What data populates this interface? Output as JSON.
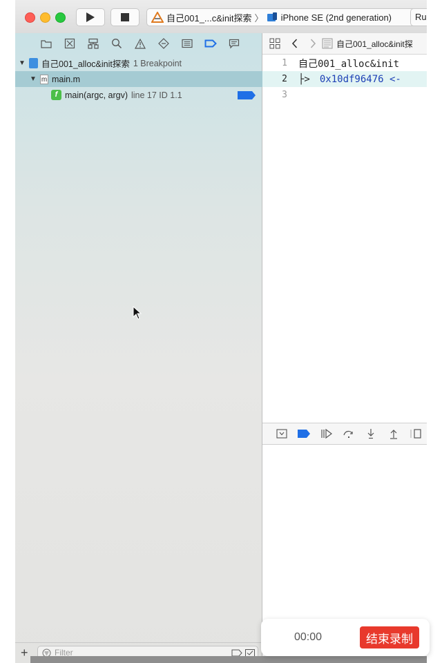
{
  "toolbar": {
    "scheme_name": "自己001_...c&init探索",
    "separator": "〉",
    "device_name": "iPhone SE (2nd generation)",
    "run_status": "Ru"
  },
  "navigator": {
    "tree": {
      "project_label": "自己001_alloc&init探索",
      "project_count": "1 Breakpoint",
      "file_label": "main.m",
      "file_icon_letter": "m",
      "breakpoint_label": "main(argc, argv)",
      "breakpoint_detail": "line 17 ID 1.1",
      "function_icon_letter": "f"
    },
    "filter_placeholder": "Filter"
  },
  "editor": {
    "jumpbar_file": "自己001_alloc&init探",
    "lines": [
      {
        "num": "1",
        "text": "自己001_alloc&init"
      },
      {
        "num": "2",
        "arrow": "├>",
        "addr": "0x10df96476 <-"
      },
      {
        "num": "3",
        "text": ""
      }
    ]
  },
  "recorder": {
    "time": "00:00",
    "stop_label": "结束录制"
  },
  "colors": {
    "accent": "#1f6fe6",
    "record_red": "#e8392c",
    "selection": "#a5cbd3"
  }
}
